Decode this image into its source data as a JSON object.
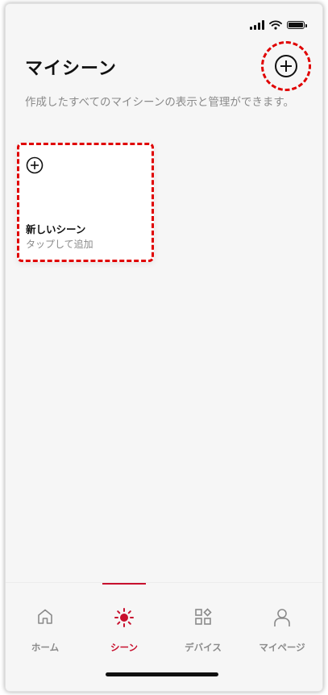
{
  "header": {
    "title": "マイシーン",
    "description": "作成したすべてのマイシーンの表示と管理ができます。",
    "add_icon": "plus-circle-icon"
  },
  "scenes": {
    "new_card": {
      "title": "新しいシーン",
      "subtitle": "タップして追加",
      "icon": "plus-circle-icon"
    }
  },
  "tabbar": {
    "active_color": "#c8102e",
    "items": [
      {
        "label": "ホーム",
        "icon": "home-icon"
      },
      {
        "label": "シーン",
        "icon": "scene-sun-icon",
        "active": true
      },
      {
        "label": "デバイス",
        "icon": "devices-icon"
      },
      {
        "label": "マイページ",
        "icon": "person-icon"
      }
    ]
  },
  "colors": {
    "highlight": "#e00000",
    "background": "#f6f6f6"
  }
}
